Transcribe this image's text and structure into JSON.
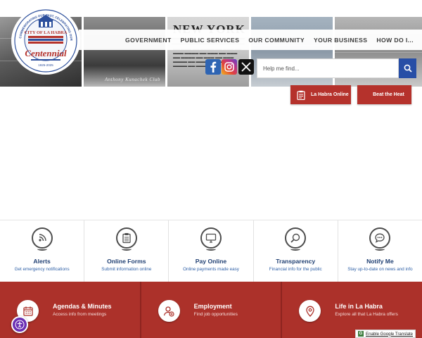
{
  "header": {
    "logo": {
      "city": "CITY OF LA HABRA",
      "ring_text": "COMMEMORATING OUR PAST, CELEBRATING OUR FUTURE",
      "script": "Centennial",
      "years": "1925-2025"
    },
    "nav": [
      "GOVERNMENT",
      "PUBLIC SERVICES",
      "OUR COMMUNITY",
      "YOUR BUSINESS",
      "HOW DO I..."
    ],
    "search": {
      "placeholder": "Help me find..."
    },
    "social": [
      "facebook-icon",
      "instagram-icon",
      "x-icon"
    ]
  },
  "hero": {
    "photo2_caption": "Anthony Kunachek Club",
    "photo3_headline": "NEW YORK",
    "quick_buttons": [
      {
        "label": "La Habra Online",
        "icon": "clipboard-icon"
      },
      {
        "label": "Beat the Heat"
      }
    ]
  },
  "quick_links": [
    {
      "title": "Alerts",
      "subtitle": "Get emergency notifications",
      "icon": "alert-icon"
    },
    {
      "title": "Online Forms",
      "subtitle": "Submit information online",
      "icon": "form-icon"
    },
    {
      "title": "Pay Online",
      "subtitle": "Online payments made easy",
      "icon": "monitor-icon"
    },
    {
      "title": "Transparency",
      "subtitle": "Financial info for the public",
      "icon": "magnifier-icon"
    },
    {
      "title": "Notify Me",
      "subtitle": "Stay up-to-date on news and info",
      "icon": "chat-icon"
    }
  ],
  "panels": [
    {
      "title": "Agendas & Minutes",
      "subtitle": "Access info from meetings",
      "icon": "calendar-icon"
    },
    {
      "title": "Employment",
      "subtitle": "Find job opportunities",
      "icon": "person-plus-icon"
    },
    {
      "title": "Life in La Habra",
      "subtitle": "Explore all that La Habra offers",
      "icon": "map-pin-icon"
    }
  ],
  "widgets": {
    "translate": "Enable Google Translate"
  },
  "colors": {
    "brand_red": "#ac312a",
    "brand_blue": "#274ea6",
    "link_blue": "#2d5fa6"
  }
}
